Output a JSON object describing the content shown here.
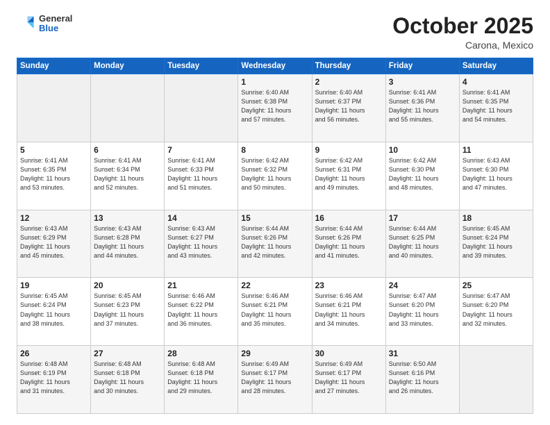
{
  "header": {
    "logo": {
      "general": "General",
      "blue": "Blue"
    },
    "title": "October 2025",
    "location": "Carona, Mexico"
  },
  "calendar": {
    "days_of_week": [
      "Sunday",
      "Monday",
      "Tuesday",
      "Wednesday",
      "Thursday",
      "Friday",
      "Saturday"
    ],
    "weeks": [
      [
        {
          "day": null,
          "info": null
        },
        {
          "day": null,
          "info": null
        },
        {
          "day": null,
          "info": null
        },
        {
          "day": "1",
          "info": "Sunrise: 6:40 AM\nSunset: 6:38 PM\nDaylight: 11 hours\nand 57 minutes."
        },
        {
          "day": "2",
          "info": "Sunrise: 6:40 AM\nSunset: 6:37 PM\nDaylight: 11 hours\nand 56 minutes."
        },
        {
          "day": "3",
          "info": "Sunrise: 6:41 AM\nSunset: 6:36 PM\nDaylight: 11 hours\nand 55 minutes."
        },
        {
          "day": "4",
          "info": "Sunrise: 6:41 AM\nSunset: 6:35 PM\nDaylight: 11 hours\nand 54 minutes."
        }
      ],
      [
        {
          "day": "5",
          "info": "Sunrise: 6:41 AM\nSunset: 6:35 PM\nDaylight: 11 hours\nand 53 minutes."
        },
        {
          "day": "6",
          "info": "Sunrise: 6:41 AM\nSunset: 6:34 PM\nDaylight: 11 hours\nand 52 minutes."
        },
        {
          "day": "7",
          "info": "Sunrise: 6:41 AM\nSunset: 6:33 PM\nDaylight: 11 hours\nand 51 minutes."
        },
        {
          "day": "8",
          "info": "Sunrise: 6:42 AM\nSunset: 6:32 PM\nDaylight: 11 hours\nand 50 minutes."
        },
        {
          "day": "9",
          "info": "Sunrise: 6:42 AM\nSunset: 6:31 PM\nDaylight: 11 hours\nand 49 minutes."
        },
        {
          "day": "10",
          "info": "Sunrise: 6:42 AM\nSunset: 6:30 PM\nDaylight: 11 hours\nand 48 minutes."
        },
        {
          "day": "11",
          "info": "Sunrise: 6:43 AM\nSunset: 6:30 PM\nDaylight: 11 hours\nand 47 minutes."
        }
      ],
      [
        {
          "day": "12",
          "info": "Sunrise: 6:43 AM\nSunset: 6:29 PM\nDaylight: 11 hours\nand 45 minutes."
        },
        {
          "day": "13",
          "info": "Sunrise: 6:43 AM\nSunset: 6:28 PM\nDaylight: 11 hours\nand 44 minutes."
        },
        {
          "day": "14",
          "info": "Sunrise: 6:43 AM\nSunset: 6:27 PM\nDaylight: 11 hours\nand 43 minutes."
        },
        {
          "day": "15",
          "info": "Sunrise: 6:44 AM\nSunset: 6:26 PM\nDaylight: 11 hours\nand 42 minutes."
        },
        {
          "day": "16",
          "info": "Sunrise: 6:44 AM\nSunset: 6:26 PM\nDaylight: 11 hours\nand 41 minutes."
        },
        {
          "day": "17",
          "info": "Sunrise: 6:44 AM\nSunset: 6:25 PM\nDaylight: 11 hours\nand 40 minutes."
        },
        {
          "day": "18",
          "info": "Sunrise: 6:45 AM\nSunset: 6:24 PM\nDaylight: 11 hours\nand 39 minutes."
        }
      ],
      [
        {
          "day": "19",
          "info": "Sunrise: 6:45 AM\nSunset: 6:24 PM\nDaylight: 11 hours\nand 38 minutes."
        },
        {
          "day": "20",
          "info": "Sunrise: 6:45 AM\nSunset: 6:23 PM\nDaylight: 11 hours\nand 37 minutes."
        },
        {
          "day": "21",
          "info": "Sunrise: 6:46 AM\nSunset: 6:22 PM\nDaylight: 11 hours\nand 36 minutes."
        },
        {
          "day": "22",
          "info": "Sunrise: 6:46 AM\nSunset: 6:21 PM\nDaylight: 11 hours\nand 35 minutes."
        },
        {
          "day": "23",
          "info": "Sunrise: 6:46 AM\nSunset: 6:21 PM\nDaylight: 11 hours\nand 34 minutes."
        },
        {
          "day": "24",
          "info": "Sunrise: 6:47 AM\nSunset: 6:20 PM\nDaylight: 11 hours\nand 33 minutes."
        },
        {
          "day": "25",
          "info": "Sunrise: 6:47 AM\nSunset: 6:20 PM\nDaylight: 11 hours\nand 32 minutes."
        }
      ],
      [
        {
          "day": "26",
          "info": "Sunrise: 6:48 AM\nSunset: 6:19 PM\nDaylight: 11 hours\nand 31 minutes."
        },
        {
          "day": "27",
          "info": "Sunrise: 6:48 AM\nSunset: 6:18 PM\nDaylight: 11 hours\nand 30 minutes."
        },
        {
          "day": "28",
          "info": "Sunrise: 6:48 AM\nSunset: 6:18 PM\nDaylight: 11 hours\nand 29 minutes."
        },
        {
          "day": "29",
          "info": "Sunrise: 6:49 AM\nSunset: 6:17 PM\nDaylight: 11 hours\nand 28 minutes."
        },
        {
          "day": "30",
          "info": "Sunrise: 6:49 AM\nSunset: 6:17 PM\nDaylight: 11 hours\nand 27 minutes."
        },
        {
          "day": "31",
          "info": "Sunrise: 6:50 AM\nSunset: 6:16 PM\nDaylight: 11 hours\nand 26 minutes."
        },
        {
          "day": null,
          "info": null
        }
      ]
    ]
  }
}
